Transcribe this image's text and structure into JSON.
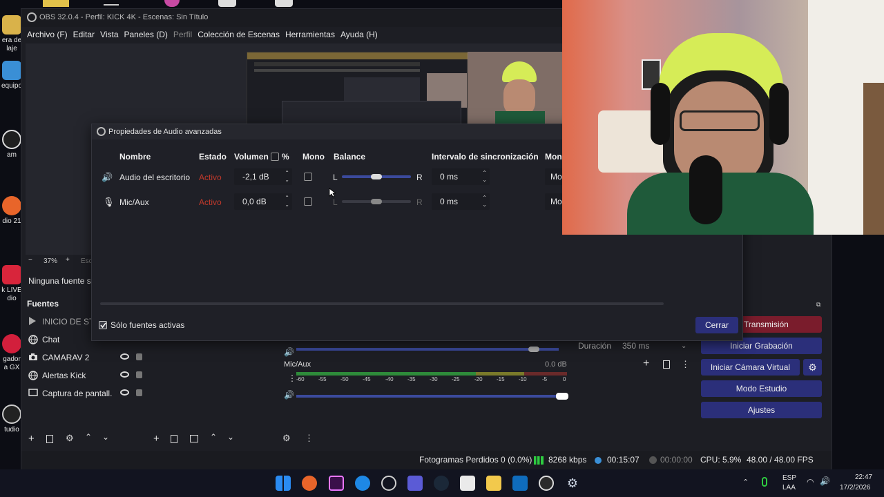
{
  "desktop_icons": [
    {
      "label": "era de\nlaje",
      "color": "#d9b24a"
    },
    {
      "label": "equipo",
      "color": "#3a8fd6"
    },
    {
      "label": "am",
      "color": "#1f1f1f"
    },
    {
      "label": "dio 21",
      "color": "#e8652a"
    },
    {
      "label": "k LIVE\ndio",
      "color": "#d8253b"
    },
    {
      "label": "gador\na GX",
      "color": "#d21f3c"
    },
    {
      "label": "tudio",
      "color": "#222"
    }
  ],
  "obs": {
    "title": "OBS 32.0.4 - Perfil: KICK 4K - Escenas: Sin Título",
    "menu": [
      "Archivo (F)",
      "Editar",
      "Vista",
      "Paneles (D)",
      "Perfil",
      "Colección de Escenas",
      "Herramientas",
      "Ayuda (H)"
    ],
    "preview_zoom": "37%",
    "preview_zoom_suffix": "Esc",
    "no_source_text": "Ninguna fuente se",
    "sources_header": "Fuentes",
    "sources": [
      {
        "label": "INICIO DE STR",
        "icon": "play-icon"
      },
      {
        "label": "Chat",
        "icon": "browser-icon"
      },
      {
        "label": "CAMARAV 2",
        "icon": "camera-icon"
      },
      {
        "label": "Alertas Kick",
        "icon": "browser-icon"
      },
      {
        "label": "Captura de pantall.",
        "icon": "monitor-icon"
      }
    ],
    "mixer": {
      "mic_label": "Mic/Aux",
      "mic_db": "0.0 dB",
      "scale": [
        "-60",
        "-55",
        "-50",
        "-45",
        "-40",
        "-35",
        "-30",
        "-25",
        "-20",
        "-15",
        "-10",
        "-5",
        "0"
      ]
    },
    "transition": {
      "label": "Duración",
      "value": "350 ms"
    },
    "controls": {
      "stream": "er Transmisión",
      "record": "Iniciar Grabación",
      "virtual_cam": "Iniciar Cámara Virtual",
      "studio": "Modo Estudio",
      "settings": "Ajustes"
    },
    "status": {
      "dropped": "Fotogramas Perdidos 0 (0.0%)",
      "bitrate": "8268 kbps",
      "stream_time": "00:15:07",
      "rec_time": "00:00:00",
      "cpu": "CPU: 5.9%",
      "fps": "48.00 / 48.00 FPS"
    }
  },
  "dialog": {
    "title": "Propiedades de Audio avanzadas",
    "headers": {
      "name": "Nombre",
      "status": "Estado",
      "volume": "Volumen",
      "percent": "%",
      "mono": "Mono",
      "balance": "Balance",
      "sync": "Intervalo de sincronización",
      "monitor": "Mon"
    },
    "rows": [
      {
        "name": "Audio del escritorio",
        "status": "Activo",
        "volume": "-2,1 dB",
        "balance_left": "L",
        "balance_right": "R",
        "balance": 0.5,
        "sync": "0 ms",
        "monitor": "Mo"
      },
      {
        "name": "Mic/Aux",
        "status": "Activo",
        "volume": "0,0 dB",
        "balance_left": "L",
        "balance_right": "R",
        "balance": 0.5,
        "sync": "0 ms",
        "monitor": "Mo"
      }
    ],
    "active_only": "Sólo fuentes activas",
    "close": "Cerrar"
  },
  "taskbar": {
    "lang1": "ESP",
    "lang2": "LAA",
    "time": "22:47",
    "date": "17/2/2026"
  }
}
